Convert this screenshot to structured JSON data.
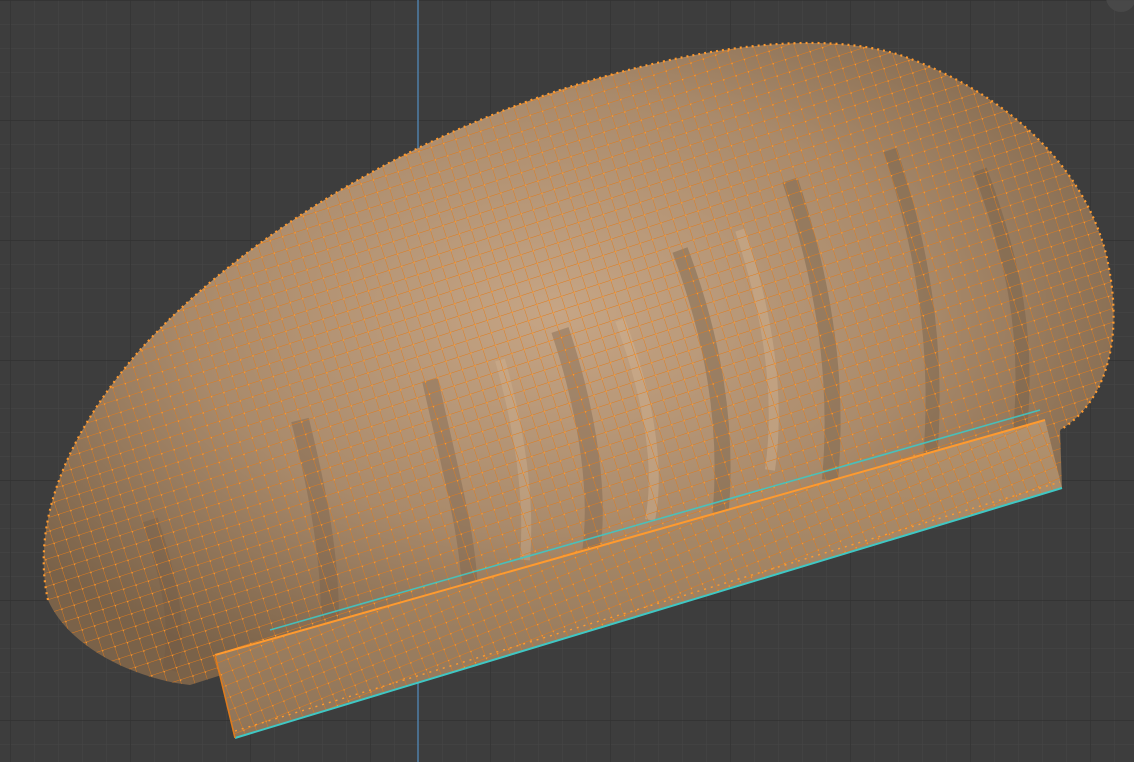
{
  "viewport": {
    "background": "#3d3d3d",
    "grid_minor_color": "#474747",
    "grid_major_color": "#333333",
    "axis_line_color": "#4f7ea8",
    "mode": "edit-mode-vertex-selection"
  },
  "mesh": {
    "object": "cap",
    "surface_color": "#a8896a",
    "surface_highlight": "#c4a383",
    "surface_shadow": "#6f5a44",
    "wire_color": "#e8821e",
    "vertex_color": "#ff9a2e",
    "seam_color": "#3fc7c4",
    "parts": [
      "puffy-crown",
      "headband"
    ],
    "selection": "all-vertices-selected"
  },
  "icons": {
    "navigation_gizmo": "navigation-gizmo-icon"
  }
}
